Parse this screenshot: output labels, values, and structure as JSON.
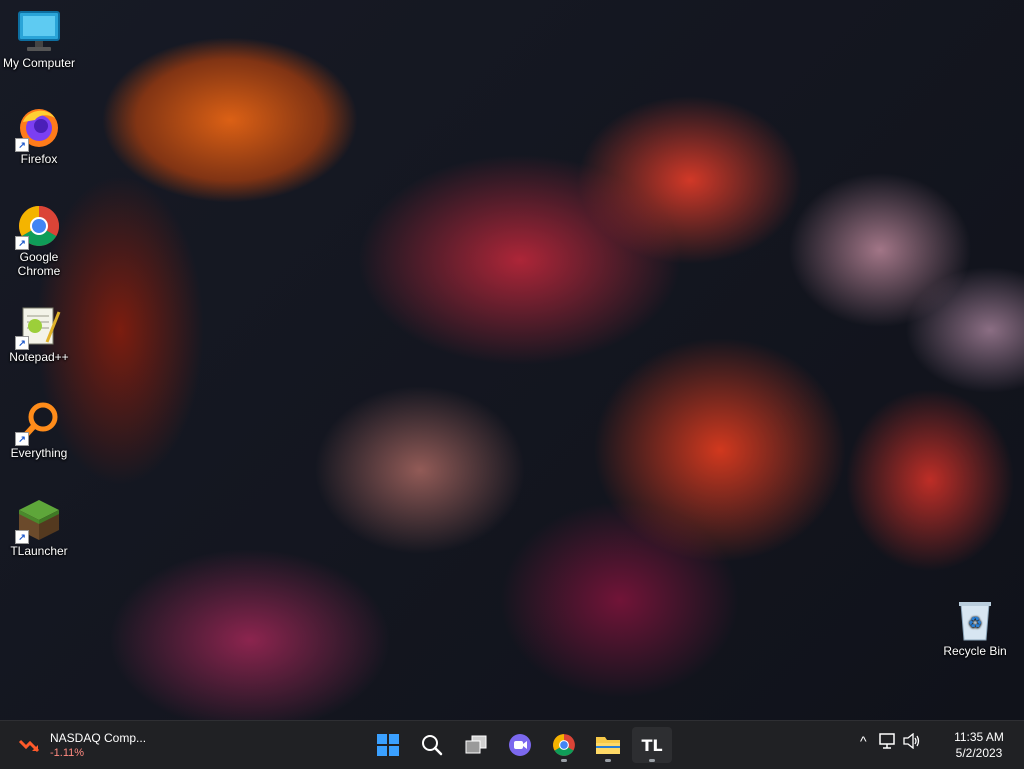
{
  "desktop": {
    "icons": [
      {
        "label": "My Computer",
        "icon": "monitor-icon"
      },
      {
        "label": "Firefox",
        "icon": "firefox-icon"
      },
      {
        "label": "Google Chrome",
        "icon": "chrome-icon"
      },
      {
        "label": "Notepad++",
        "icon": "notepad-plus-plus-icon"
      },
      {
        "label": "Everything",
        "icon": "search-magnifier-icon"
      },
      {
        "label": "TLauncher",
        "icon": "grass-block-icon"
      }
    ],
    "recycle_bin": {
      "label": "Recycle Bin",
      "icon": "recycle-bin-icon"
    }
  },
  "taskbar": {
    "widget": {
      "title": "NASDAQ Comp...",
      "change": "-1.11%",
      "change_color": "#ff8a80"
    },
    "apps": [
      {
        "name": "Start",
        "icon": "windows-start-icon"
      },
      {
        "name": "Search",
        "icon": "search-icon"
      },
      {
        "name": "Task View",
        "icon": "task-view-icon"
      },
      {
        "name": "Chat",
        "icon": "video-chat-icon"
      },
      {
        "name": "Google Chrome",
        "icon": "chrome-icon",
        "running": true
      },
      {
        "name": "File Explorer",
        "icon": "folder-icon",
        "running": true
      },
      {
        "name": "TLauncher",
        "icon": "tlauncher-icon",
        "running": true,
        "active": true
      }
    ],
    "tray": {
      "chevron": "^",
      "network_icon": "network-icon",
      "volume_icon": "speaker-icon"
    },
    "clock": {
      "time": "11:35 AM",
      "date": "5/2/2023"
    }
  }
}
